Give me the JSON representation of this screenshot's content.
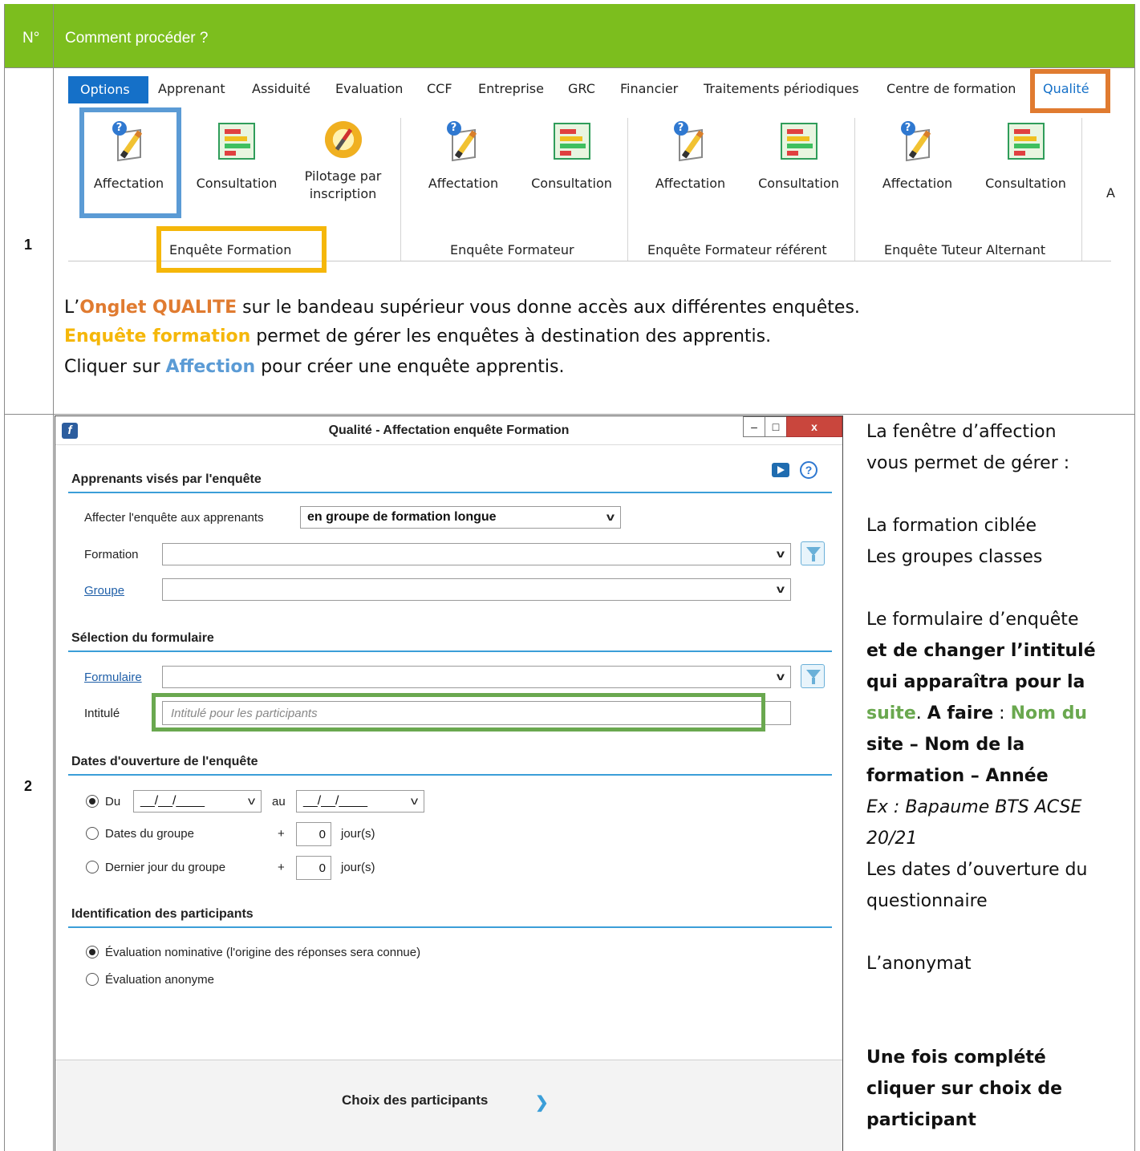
{
  "header": {
    "num": "N°",
    "title": "Comment procéder ?"
  },
  "rows": {
    "r1": "1",
    "r2": "2"
  },
  "ribbon": {
    "tabs": [
      "Options",
      "Apprenant",
      "Assiduité",
      "Evaluation",
      "CCF",
      "Entreprise",
      "GRC",
      "Financier",
      "Traitements périodiques",
      "Centre de formation",
      "Qualité"
    ],
    "buttons": [
      "Affectation",
      "Consultation",
      "Pilotage par",
      "inscription",
      "Affectation",
      "Consultation",
      "Affectation",
      "Consultation",
      "Affectation",
      "Consultation"
    ],
    "groups": [
      "Enquête Formation",
      "Enquête Formateur",
      "Enquête Formateur référent",
      "Enquête Tuteur Alternant"
    ],
    "cutoff": "A"
  },
  "row1_text": {
    "l1a": "L’",
    "l1b": "Onglet QUALITE",
    "l1c": " sur le bandeau supérieur vous donne accès aux différentes enquêtes.",
    "l2a": "Enquête formation",
    "l2b": " permet de gérer les enquêtes à destination des apprentis.",
    "l3a": "Cliquer sur ",
    "l3b": "Affection",
    "l3c": " pour créer une enquête apprentis."
  },
  "dialog": {
    "icon": "f",
    "title": "Qualité - Affectation enquête Formation",
    "win_min": "–",
    "win_max": "□",
    "win_close": "x",
    "help": "?",
    "sec1": "Apprenants visés par l'enquête",
    "affect_label": "Affecter l'enquête aux apprenants",
    "affect_value": "en groupe de formation longue",
    "formation_label": "Formation",
    "groupe_label": "Groupe",
    "sec2": "Sélection du formulaire",
    "formulaire_label": "Formulaire",
    "intitule_label": "Intitulé",
    "intitule_placeholder": "Intitulé pour les participants",
    "sec3": "Dates d'ouverture de l'enquête",
    "du": "Du",
    "date_from": "__/__/____",
    "au": "au",
    "date_to": "__/__/____",
    "dates_groupe": "Dates du groupe",
    "dernier_jour": "Dernier jour du groupe",
    "plus": "+",
    "days1": "0",
    "days2": "0",
    "jours": "jour(s)",
    "sec4": "Identification des participants",
    "nominative": "Évaluation nominative (l'origine des réponses sera connue)",
    "anonyme": "Évaluation anonyme",
    "footer_button": "Choix des participants",
    "chev": "❯"
  },
  "row2_text": {
    "a": "La fenêtre d’affection",
    "b": "vous permet de gérer :",
    "c": "La formation ciblée",
    "d": "Les groupes classes",
    "e": "Le formulaire d’enquête",
    "f": "et de changer l’intitulé",
    "g": "qui apparaîtra pour la",
    "h1": "suite",
    "h2": ". ",
    "h3": "A faire",
    "h4": " : ",
    "h5": "Nom du",
    "i": "site – Nom de la",
    "j": "formation – Année",
    "k": "Ex : Bapaume BTS ACSE",
    "l": "20/21",
    "m": "Les dates d’ouverture du",
    "n": "questionnaire",
    "o": "L’anonymat",
    "p": "Une fois complété",
    "q": "cliquer sur choix de",
    "r": "participant"
  },
  "colors": {
    "header": "#7cbe1e",
    "orange": "#e07b30",
    "yellow": "#f5b70a",
    "blue": "#5b9bd5",
    "green": "#6aa84f"
  }
}
